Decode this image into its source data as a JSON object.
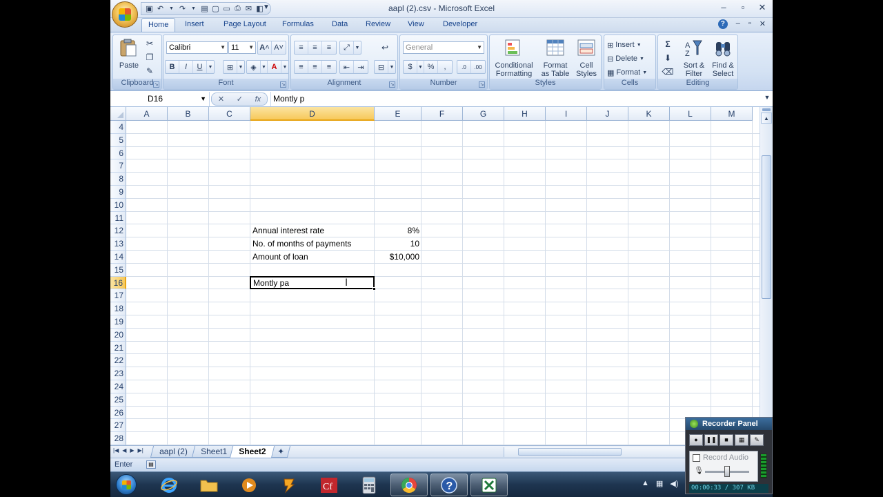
{
  "window": {
    "title": "aapl (2).csv - Microsoft Excel",
    "controls": [
      "minimize",
      "maximize",
      "close"
    ]
  },
  "ribbon_tabs": [
    {
      "label": "Home",
      "active": true
    },
    {
      "label": "Insert"
    },
    {
      "label": "Page Layout"
    },
    {
      "label": "Formulas"
    },
    {
      "label": "Data"
    },
    {
      "label": "Review"
    },
    {
      "label": "View"
    },
    {
      "label": "Developer"
    }
  ],
  "ribbon": {
    "clipboard": {
      "paste_label": "Paste",
      "group_label": "Clipboard"
    },
    "font": {
      "name": "Calibri",
      "size": "11",
      "group_label": "Font"
    },
    "alignment": {
      "group_label": "Alignment"
    },
    "number": {
      "format": "General",
      "group_label": "Number"
    },
    "styles": {
      "conditional_1": "Conditional",
      "conditional_2": "Formatting",
      "format_table_1": "Format",
      "format_table_2": "as Table",
      "cell_styles_1": "Cell",
      "cell_styles_2": "Styles",
      "group_label": "Styles"
    },
    "cells": {
      "insert": "Insert",
      "delete": "Delete",
      "format": "Format",
      "group_label": "Cells"
    },
    "editing": {
      "sort_1": "Sort &",
      "sort_2": "Filter",
      "find_1": "Find &",
      "find_2": "Select",
      "group_label": "Editing"
    }
  },
  "formula_bar": {
    "name_box": "D16",
    "formula": "Montly p"
  },
  "grid": {
    "columns": [
      "A",
      "B",
      "C",
      "D",
      "E",
      "F",
      "G",
      "H",
      "I",
      "J",
      "K",
      "L",
      "M"
    ],
    "selected_column": "D",
    "rows": [
      "4",
      "5",
      "6",
      "7",
      "8",
      "9",
      "10",
      "11",
      "12",
      "13",
      "14",
      "15",
      "16",
      "17",
      "18",
      "19",
      "20",
      "21",
      "22",
      "23",
      "24",
      "25",
      "26",
      "27",
      "28"
    ],
    "selected_row": "16",
    "cells": {
      "D12": "Annual interest rate",
      "E12": "8%",
      "D13": "No. of months of payments",
      "E13": "10",
      "D14": "Amount of loan",
      "E14": "$10,000"
    },
    "active_cell": {
      "ref": "D16",
      "text": "Montly pa"
    }
  },
  "sheet_tabs": [
    {
      "label": "aapl (2)"
    },
    {
      "label": "Sheet1"
    },
    {
      "label": "Sheet2",
      "active": true
    }
  ],
  "status_bar": {
    "mode": "Enter"
  },
  "taskbar": {
    "apps": [
      "internet-explorer",
      "file-explorer",
      "media-player",
      "winamp",
      "coldfusion",
      "calculator",
      "chrome",
      "help",
      "excel"
    ],
    "active_app": "excel"
  },
  "recorder": {
    "title": "Recorder Panel",
    "audio_label": "Record Audio",
    "time": "00:00:33 / 307 KB"
  }
}
